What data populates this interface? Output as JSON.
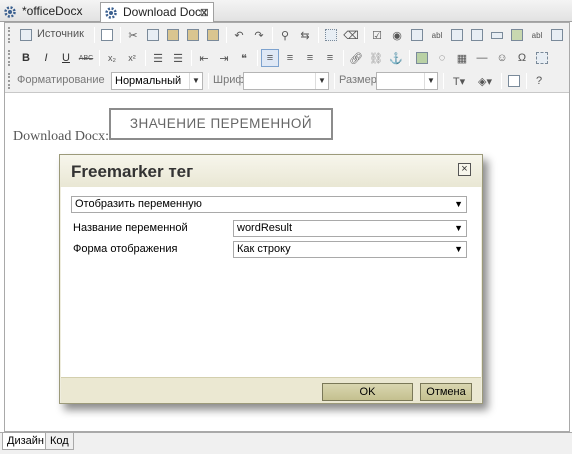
{
  "tabs": [
    {
      "label": "*officeDocx",
      "active": false
    },
    {
      "label": "Download Docx",
      "active": true,
      "close": "⊠"
    }
  ],
  "toolbar": {
    "source_label": "Источник",
    "bold": "B",
    "italic": "I",
    "underline": "U",
    "strike": "ABC",
    "subscript": "x₂",
    "superscript": "x²",
    "format_label": "Форматирование",
    "format_value": "Нормальный",
    "font_label": "Шрифт",
    "font_value": "",
    "size_label": "Размер",
    "size_value": ""
  },
  "content": {
    "label": "Download Docx:",
    "variable_placeholder": "ЗНАЧЕНИЕ ПЕРЕМЕННОЙ"
  },
  "dialog": {
    "title": "Freemarker тег",
    "close": "⊠",
    "mode_value": "Отобразить переменную",
    "var_name_label": "Название переменной",
    "var_name_value": "wordResult",
    "display_form_label": "Форма отображения",
    "display_form_value": "Как строку",
    "ok_label": "OK",
    "cancel_label": "Отмена"
  },
  "bottom_tabs": [
    {
      "label": "Дизайн",
      "active": true
    },
    {
      "label": "Код",
      "active": false
    }
  ]
}
